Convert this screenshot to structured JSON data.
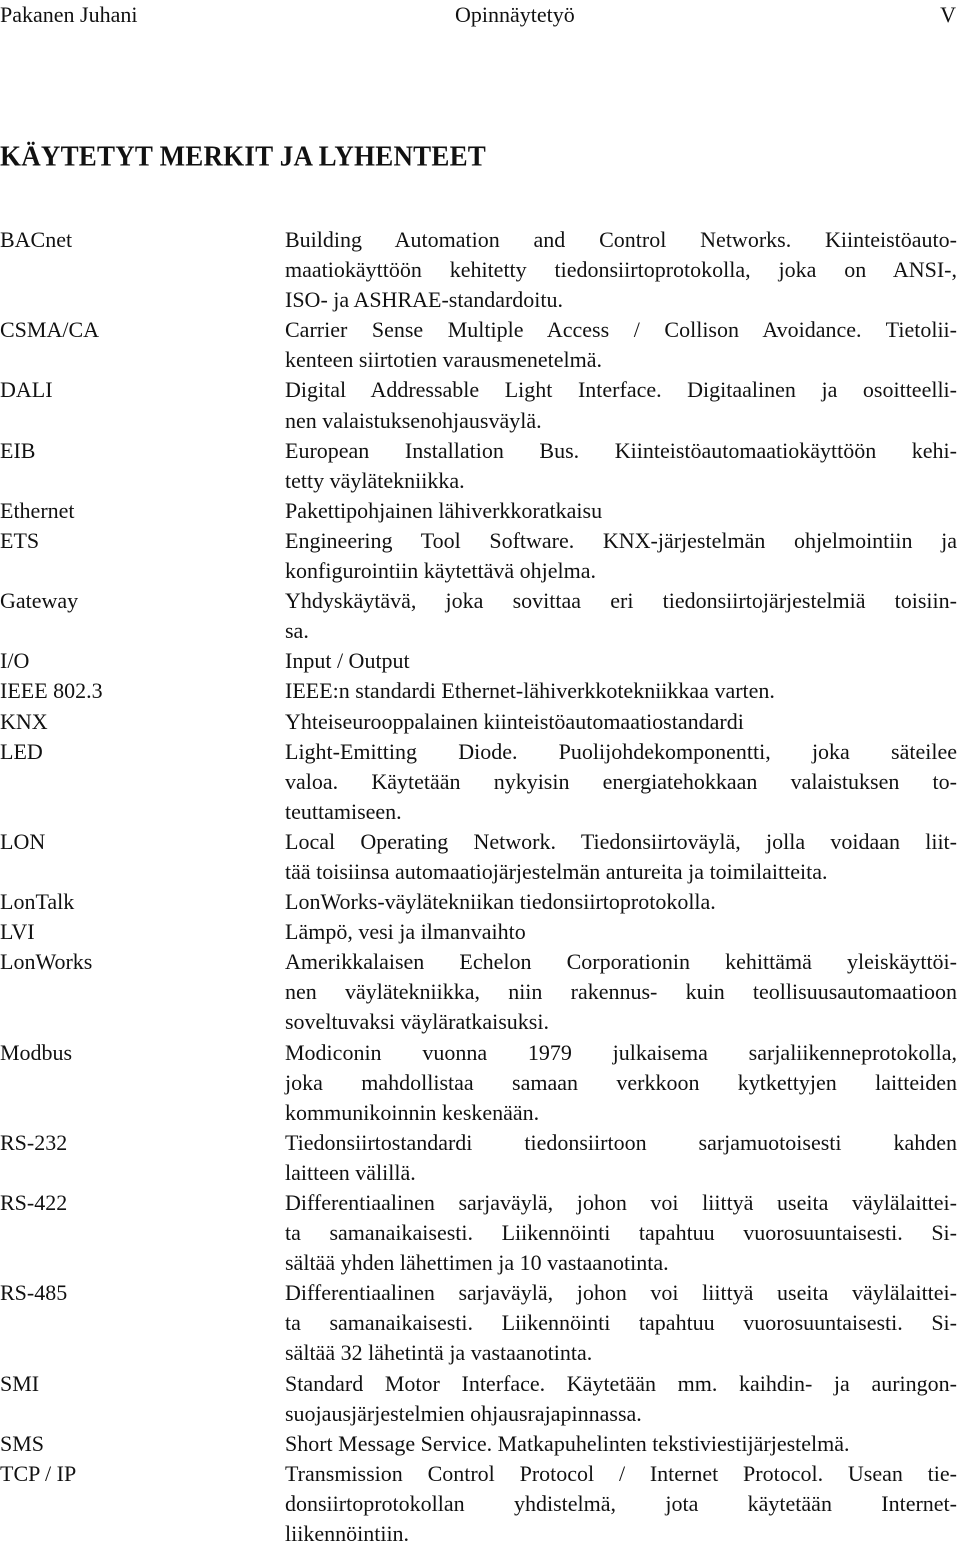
{
  "header": {
    "author": "Pakanen Juhani",
    "document_type": "Opinnäytetyö",
    "page_number": "V"
  },
  "page_title": "KÄYTETYT MERKIT JA LYHENTEET",
  "glossary": [
    {
      "term": "BACnet",
      "lines": [
        "Building Automation and Control Networks. Kiinteistöauto-",
        "maatiokäyttöön kehitetty tiedonsiirtoprotokolla, joka on ANSI-,",
        "ISO- ja ASHRAE-standardoitu."
      ]
    },
    {
      "term": "CSMA/CA",
      "lines": [
        "Carrier Sense Multiple Access / Collison Avoidance. Tietolii-",
        "kenteen siirtotien varausmenetelmä."
      ]
    },
    {
      "term": "DALI",
      "lines": [
        "Digital Addressable Light Interface. Digitaalinen ja osoitteelli-",
        "nen valaistuksenohjausväylä."
      ]
    },
    {
      "term": "EIB",
      "lines": [
        "European Installation Bus. Kiinteistöautomaatiokäyttöön kehi-",
        "tetty väylätekniikka."
      ]
    },
    {
      "term": "Ethernet",
      "lines": [
        "Pakettipohjainen lähiverkkoratkaisu"
      ]
    },
    {
      "term": "ETS",
      "lines": [
        "Engineering Tool Software. KNX-järjestelmän ohjelmointiin ja",
        "konfigurointiin käytettävä ohjelma."
      ]
    },
    {
      "term": "Gateway",
      "lines": [
        "Yhdyskäytävä, joka sovittaa eri tiedonsiirtojärjestelmiä toisiin-",
        "sa."
      ]
    },
    {
      "term": "I/O",
      "lines": [
        "Input / Output"
      ]
    },
    {
      "term": "IEEE 802.3",
      "lines": [
        "IEEE:n standardi Ethernet-lähiverkkotekniikkaa varten."
      ]
    },
    {
      "term": "KNX",
      "lines": [
        "Yhteiseurooppalainen kiinteistöautomaatiostandardi"
      ]
    },
    {
      "term": "LED",
      "lines": [
        "Light-Emitting Diode. Puolijohdekomponentti, joka säteilee",
        "valoa. Käytetään nykyisin energiatehokkaan valaistuksen to-",
        "teuttamiseen."
      ]
    },
    {
      "term": "LON",
      "lines": [
        "Local Operating Network. Tiedonsiirtoväylä, jolla voidaan liit-",
        "tää toisiinsa automaatiojärjestelmän antureita ja toimilaitteita."
      ]
    },
    {
      "term": "LonTalk",
      "lines": [
        "LonWorks-väylätekniikan tiedonsiirtoprotokolla."
      ]
    },
    {
      "term": "LVI",
      "lines": [
        "Lämpö, vesi ja ilmanvaihto"
      ]
    },
    {
      "term": "LonWorks",
      "lines": [
        "Amerikkalaisen Echelon Corporationin kehittämä yleiskäyttöi-",
        "nen väylätekniikka, niin rakennus- kuin teollisuusautomaatioon",
        "soveltuvaksi väyläratkaisuksi."
      ]
    },
    {
      "term": "Modbus",
      "lines": [
        "Modiconin vuonna 1979 julkaisema sarjaliikenneprotokolla,",
        "joka mahdollistaa samaan verkkoon kytkettyjen laitteiden",
        "kommunikoinnin keskenään."
      ]
    },
    {
      "term": "RS-232",
      "lines": [
        "Tiedonsiirtostandardi tiedonsiirtoon sarjamuotoisesti kahden",
        "laitteen välillä."
      ]
    },
    {
      "term": "RS-422",
      "lines": [
        "Differentiaalinen sarjaväylä, johon voi liittyä useita väylälaittei-",
        "ta samanaikaisesti. Liikennöinti tapahtuu vuorosuuntaisesti. Si-",
        "sältää yhden lähettimen ja 10 vastaanotinta."
      ]
    },
    {
      "term": "RS-485",
      "lines": [
        "Differentiaalinen sarjaväylä, johon voi liittyä useita väylälaittei-",
        "ta samanaikaisesti. Liikennöinti tapahtuu vuorosuuntaisesti. Si-",
        "sältää 32 lähetintä ja vastaanotinta."
      ]
    },
    {
      "term": "SMI",
      "lines": [
        "Standard Motor Interface. Käytetään mm. kaihdin- ja auringon-",
        "suojausjärjestelmien ohjausrajapinnassa."
      ]
    },
    {
      "term": "SMS",
      "lines": [
        "Short Message Service. Matkapuhelinten tekstiviestijärjestelmä."
      ]
    },
    {
      "term": "TCP / IP",
      "lines": [
        "Transmission Control Protocol / Internet Protocol. Usean tie-",
        "donsiirtoprotokollan yhdistelmä, jota käytetään Internet-",
        "liikennöintiin."
      ]
    }
  ]
}
